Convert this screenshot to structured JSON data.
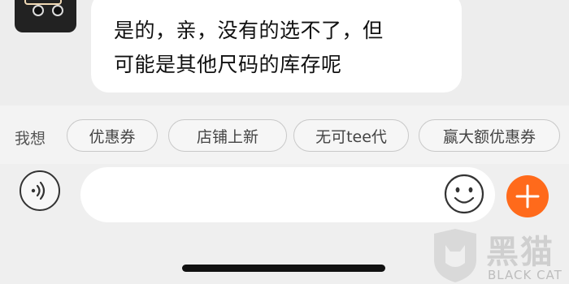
{
  "chat": {
    "message_lines": [
      "是的，亲，没有的选不了，但",
      "可能是其他尺码的库存呢"
    ]
  },
  "quick_replies": {
    "label": "我想",
    "chips": [
      "优惠券",
      "店铺上新",
      "无可tee代",
      "赢大额优惠券"
    ]
  },
  "input": {
    "value": "",
    "placeholder": ""
  },
  "icons": {
    "voice": "voice-wave-icon",
    "emoji": "smiley-icon",
    "plus": "plus-icon",
    "avatar": "cat-avatar-icon"
  },
  "colors": {
    "accent": "#ff6a1b",
    "bubble": "#ffffff",
    "background": "#ededed"
  },
  "watermark": {
    "cn": "黑猫",
    "en": "BLACK CAT"
  }
}
